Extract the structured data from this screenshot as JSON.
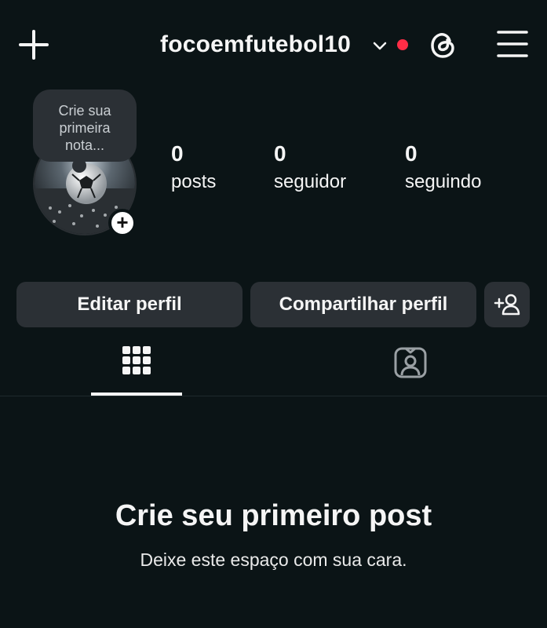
{
  "header": {
    "username": "focoemfutebol10",
    "icons": [
      "plus-icon",
      "chevron-down-icon",
      "notification-dot",
      "threads-icon",
      "menu-icon"
    ],
    "dot_color": "#ff2d46"
  },
  "profile": {
    "note_text": "Crie sua primeira nota...",
    "add_story_symbol": "+",
    "stats": [
      {
        "value": "0",
        "label": "posts"
      },
      {
        "value": "0",
        "label": "seguidor"
      },
      {
        "value": "0",
        "label": "seguindo"
      }
    ]
  },
  "actions": {
    "edit_label": "Editar perfil",
    "share_label": "Compartilhar perfil",
    "discover_icon": "add-person-icon"
  },
  "tabs": {
    "items": [
      "grid-icon",
      "tagged-icon"
    ],
    "active": "grid-icon"
  },
  "empty_state": {
    "title": "Crie seu primeiro post",
    "subtitle": "Deixe este espaço com sua cara."
  },
  "colors": {
    "background": "#0b1416",
    "button": "#2b3035",
    "text": "#f5f5f5"
  }
}
